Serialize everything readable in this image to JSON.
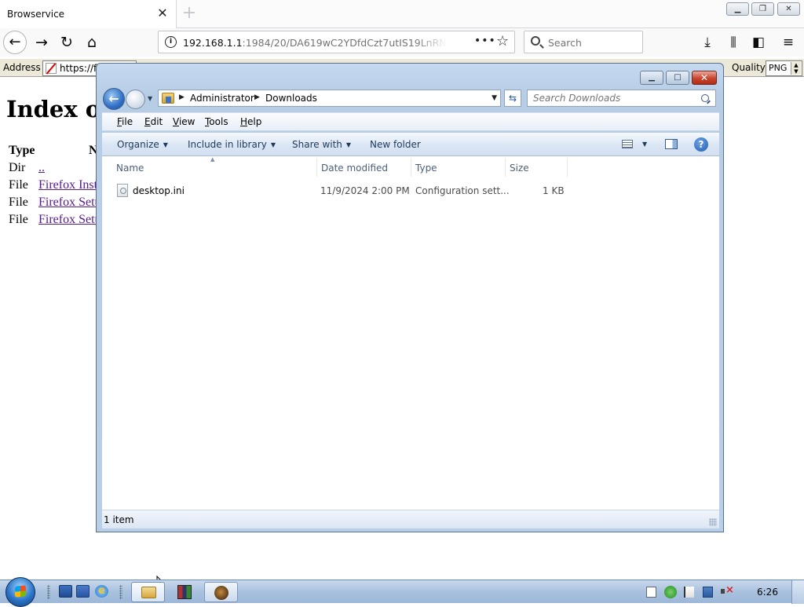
{
  "browser": {
    "tab_title": "Browservice",
    "tab_close_glyph": "✕",
    "new_tab_glyph": "+",
    "url_host": "192.168.1.1",
    "url_rest": ":1984/20/DA619wC2YDfdCzt7utIS19LnRN",
    "search_placeholder": "Search",
    "icons": [
      "back-icon",
      "forward-icon",
      "reload-icon",
      "home-icon",
      "info-icon",
      "page-actions-icon",
      "bookmark-star-icon",
      "search-icon",
      "download-icon",
      "library-icon",
      "sidebar-icon",
      "menu-icon"
    ]
  },
  "browservice_toolbar": {
    "address_label": "Address",
    "address_value": "https://ff",
    "quality_label": "Quality",
    "quality_value": "PNG"
  },
  "remote_page": {
    "heading": "Index of",
    "col_type": "Type",
    "col_name": "N",
    "rows": [
      {
        "type": "Dir",
        "name": ".."
      },
      {
        "type": "File",
        "name": "Firefox Inst"
      },
      {
        "type": "File",
        "name": "Firefox Setu"
      },
      {
        "type": "File",
        "name": "Firefox Setu"
      }
    ]
  },
  "explorer": {
    "breadcrumb": [
      "Administrator",
      "Downloads"
    ],
    "search_placeholder": "Search Downloads",
    "menu": [
      {
        "label": "File",
        "u": "F",
        "rest": "ile"
      },
      {
        "label": "Edit",
        "u": "E",
        "rest": "dit"
      },
      {
        "label": "View",
        "u": "V",
        "rest": "iew"
      },
      {
        "label": "Tools",
        "u": "T",
        "rest": "ools"
      },
      {
        "label": "Help",
        "u": "H",
        "rest": "elp"
      }
    ],
    "commands": {
      "organize": "Organize",
      "include": "Include in library",
      "share": "Share with",
      "new_folder": "New folder",
      "help_glyph": "?"
    },
    "columns": [
      "Name",
      "Date modified",
      "Type",
      "Size"
    ],
    "files": [
      {
        "name": "desktop.ini",
        "date_modified": "11/9/2024 2:00 PM",
        "type": "Configuration sett...",
        "size": "1 KB"
      }
    ],
    "status": "1 item"
  },
  "taskbar": {
    "clock": "6:26"
  },
  "colors": {
    "visited_link": "#551a8b",
    "explorer_frame": "#b9cee7",
    "taskbar": "#a9c1de",
    "close_button": "#c8452d"
  }
}
